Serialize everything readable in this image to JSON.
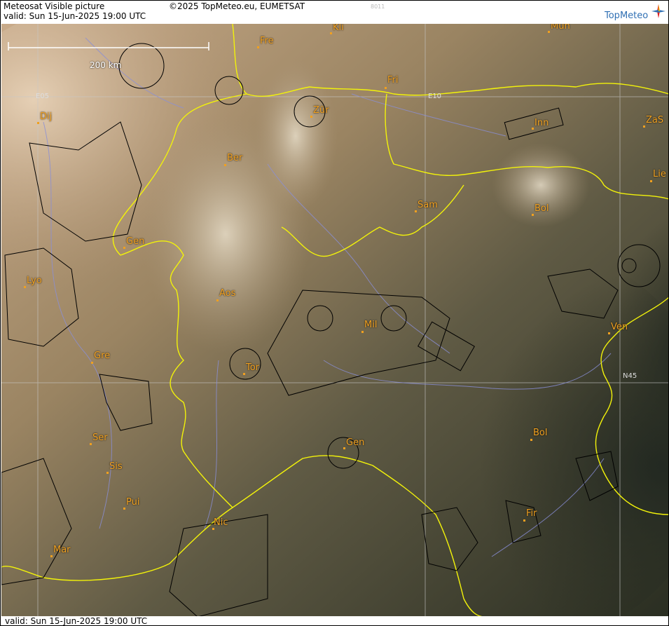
{
  "header": {
    "title": "Meteosat Visible picture",
    "copyright": "©2025 TopMeteo.eu, EUMETSAT",
    "code": "8011",
    "valid": "valid:  Sun  15-Jun-2025  19:00 UTC",
    "brand": "TopMeteo"
  },
  "map": {
    "scale": "200 km",
    "grid_labels": [
      "E05",
      "E10",
      "N45"
    ],
    "cities": [
      "Dij",
      "Fre",
      "Kli",
      "Mun",
      "Fri",
      "Zür",
      "Inn",
      "ZaS",
      "Ber",
      "Lie",
      "Sam",
      "Bol",
      "Gen",
      "Lyo",
      "Aos",
      "Mil",
      "Ven",
      "Gre",
      "Tor",
      "Ser",
      "Gen",
      "Bol",
      "Sis",
      "Pui",
      "Nic",
      "Fir",
      "Mar"
    ]
  },
  "footer": {
    "valid": "valid:  Sun  15-Jun-2025  19:00 UTC"
  }
}
